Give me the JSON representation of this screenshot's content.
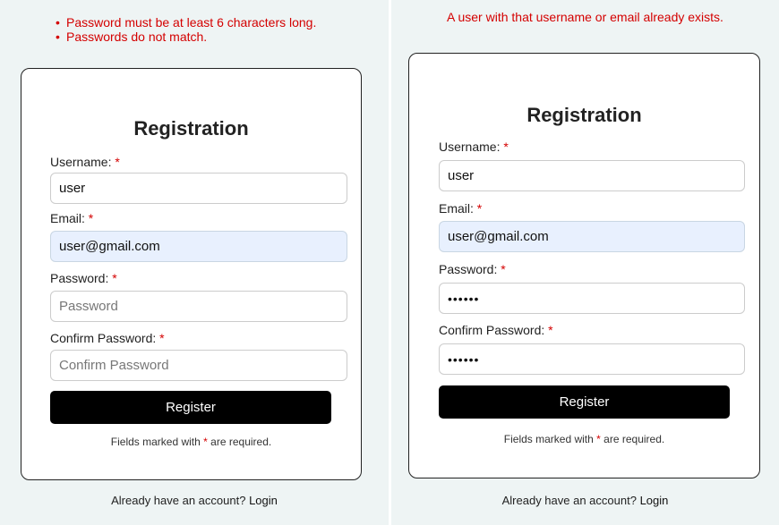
{
  "left": {
    "errors": [
      "Password must be at least 6 characters long.",
      "Passwords do not match."
    ],
    "title": "Registration",
    "username_label": "Username:",
    "username_value": "user",
    "email_label": "Email:",
    "email_value": "user@gmail.com",
    "password_label": "Password:",
    "password_placeholder": "Password",
    "confirm_label": "Confirm Password:",
    "confirm_placeholder": "Confirm Password",
    "register_label": "Register",
    "note_prefix": "Fields marked with",
    "note_suffix": "are required.",
    "footer_text": "Already have an account?",
    "login_link": "Login"
  },
  "right": {
    "error": "A user with that username or email already exists.",
    "title": "Registration",
    "username_label": "Username:",
    "username_value": "user",
    "email_label": "Email:",
    "email_value": "user@gmail.com",
    "password_label": "Password:",
    "password_value": "••••••",
    "confirm_label": "Confirm Password:",
    "confirm_value": "••••••",
    "register_label": "Register",
    "note_prefix": "Fields marked with",
    "note_suffix": "are required.",
    "footer_text": "Already have an account?",
    "login_link": "Login"
  },
  "required_marker": "*",
  "colors": {
    "error": "#d40000",
    "panel_bg": "#eef4f4",
    "button_bg": "#000000",
    "autofill_bg": "#e8f0fe"
  }
}
